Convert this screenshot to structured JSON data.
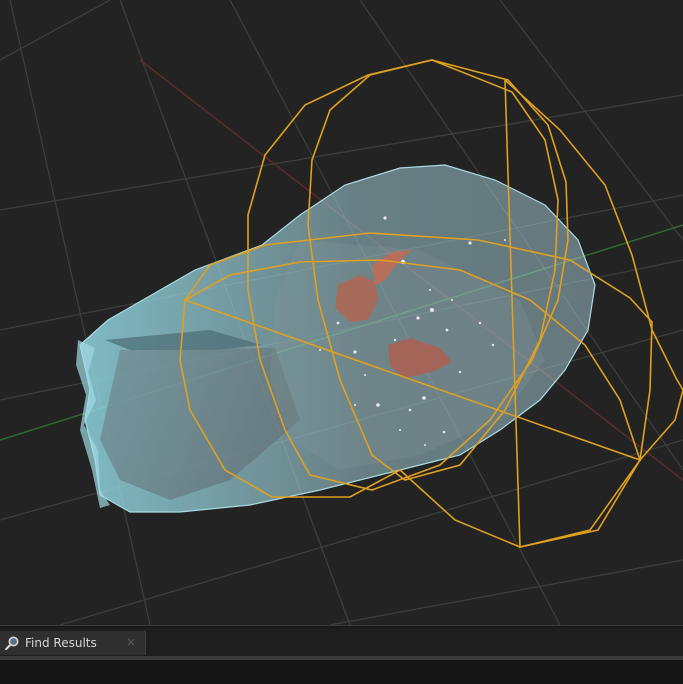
{
  "viewport": {
    "name": "3d-viewport",
    "colors": {
      "background": "#232323",
      "grid": "#3a3f3a",
      "x_axis": "#6a2a2a",
      "y_axis": "#2f6a2f",
      "shell": "#8fd0db",
      "inner_mesh": "#c0604a",
      "collision_wireframe": "#e0a020",
      "particles": "#e8e8e8"
    }
  },
  "bottom_panel": {
    "tabs": [
      {
        "label": "Find Results",
        "icon": "search-icon",
        "close_glyph": "×",
        "active": true
      }
    ]
  }
}
